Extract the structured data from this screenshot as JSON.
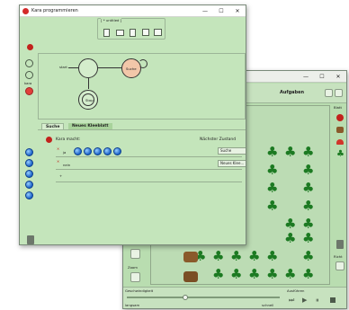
{
  "back_window": {
    "title_controls": [
      "—",
      "☐",
      "✕"
    ],
    "toolbar_label": "Aufgaben",
    "side_label_top": "Blatt",
    "side_label_bottom": "Richt",
    "left_label": "Zoom",
    "speed_label": "Geschwindigkeit",
    "speed_min": "langsam",
    "speed_max": "schnell",
    "playback_label": "Ausführen",
    "speed_level": 0.38
  },
  "front_window": {
    "title": "Kara programmieren",
    "title_controls": [
      "—",
      "☐",
      "✕"
    ],
    "toolbar_group": "[ * untitled ]",
    "states": [
      {
        "label": "Suche"
      },
      {
        "label": "Stop"
      }
    ],
    "start_label": "start",
    "tabs": [
      "Suche",
      "Neues Kleeblatt"
    ],
    "transition_header_left": "Kara macht:",
    "transition_header_right": "Nächster Zustand",
    "transitions": [
      {
        "condition": "ja",
        "next_state": "Suche"
      },
      {
        "condition": "nein",
        "next_state": "Neues Klee..."
      },
      {
        "condition": "+",
        "next_state": ""
      }
    ],
    "left_mode_label": "kara"
  },
  "colors": {
    "panel_green": "#c4e5bb",
    "state_active": "#f2c7a9",
    "ball_blue": "#1b62c9",
    "clover_green": "#1c7a22",
    "close_red": "#d42a2a"
  }
}
